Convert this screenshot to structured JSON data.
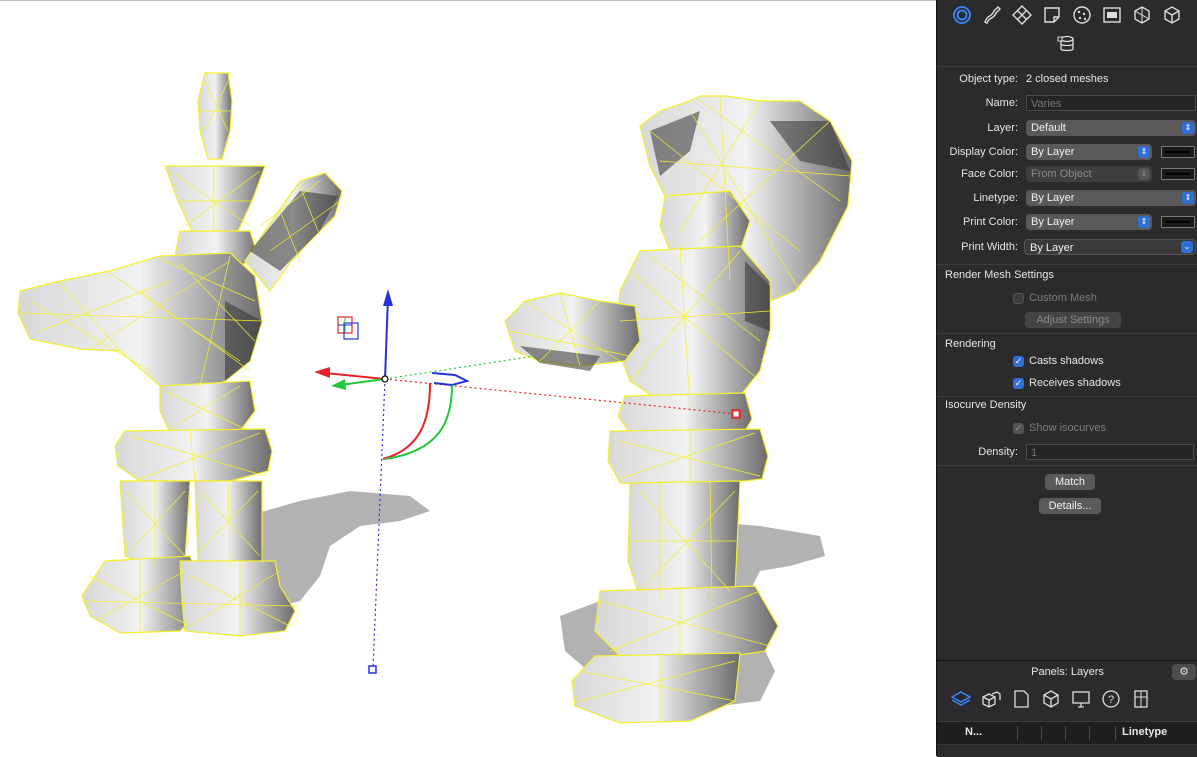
{
  "viewport": {
    "description_icon": "mesh-wireframe"
  },
  "panel": {
    "tabs": [
      "object-properties-icon",
      "curve-icon",
      "material-icon",
      "sheet-icon",
      "texture-icon",
      "decal-icon",
      "mesh-icon",
      "cube-icon",
      "layers-db-icon"
    ],
    "object_type_label": "Object type:",
    "object_type_value": "2 closed meshes",
    "name_label": "Name:",
    "name_placeholder": "Varies",
    "layer_label": "Layer:",
    "layer_value": "Default",
    "display_color_label": "Display Color:",
    "display_color_value": "By Layer",
    "face_color_label": "Face Color:",
    "face_color_value": "From Object",
    "linetype_label": "Linetype:",
    "linetype_value": "By Layer",
    "print_color_label": "Print Color:",
    "print_color_value": "By Layer",
    "print_width_label": "Print Width:",
    "print_width_value": "By Layer",
    "render_mesh_title": "Render Mesh Settings",
    "custom_mesh_label": "Custom Mesh",
    "adjust_settings_label": "Adjust Settings",
    "rendering_title": "Rendering",
    "casts_shadows_label": "Casts shadows",
    "receives_shadows_label": "Receives shadows",
    "isocurve_title": "Isocurve Density",
    "show_isocurves_label": "Show isocurves",
    "density_label": "Density:",
    "density_value": "1",
    "match_label": "Match",
    "details_label": "Details..."
  },
  "layers_panel": {
    "title": "Panels: Layers",
    "gear": "⚙",
    "col_name": "N...",
    "col_linetype": "Linetype"
  },
  "colors": {
    "accent": "#2f6fd6",
    "wire": "#f5f02a",
    "axis_x": "#e8202a",
    "axis_y": "#22c83a",
    "axis_z": "#2432d8"
  }
}
